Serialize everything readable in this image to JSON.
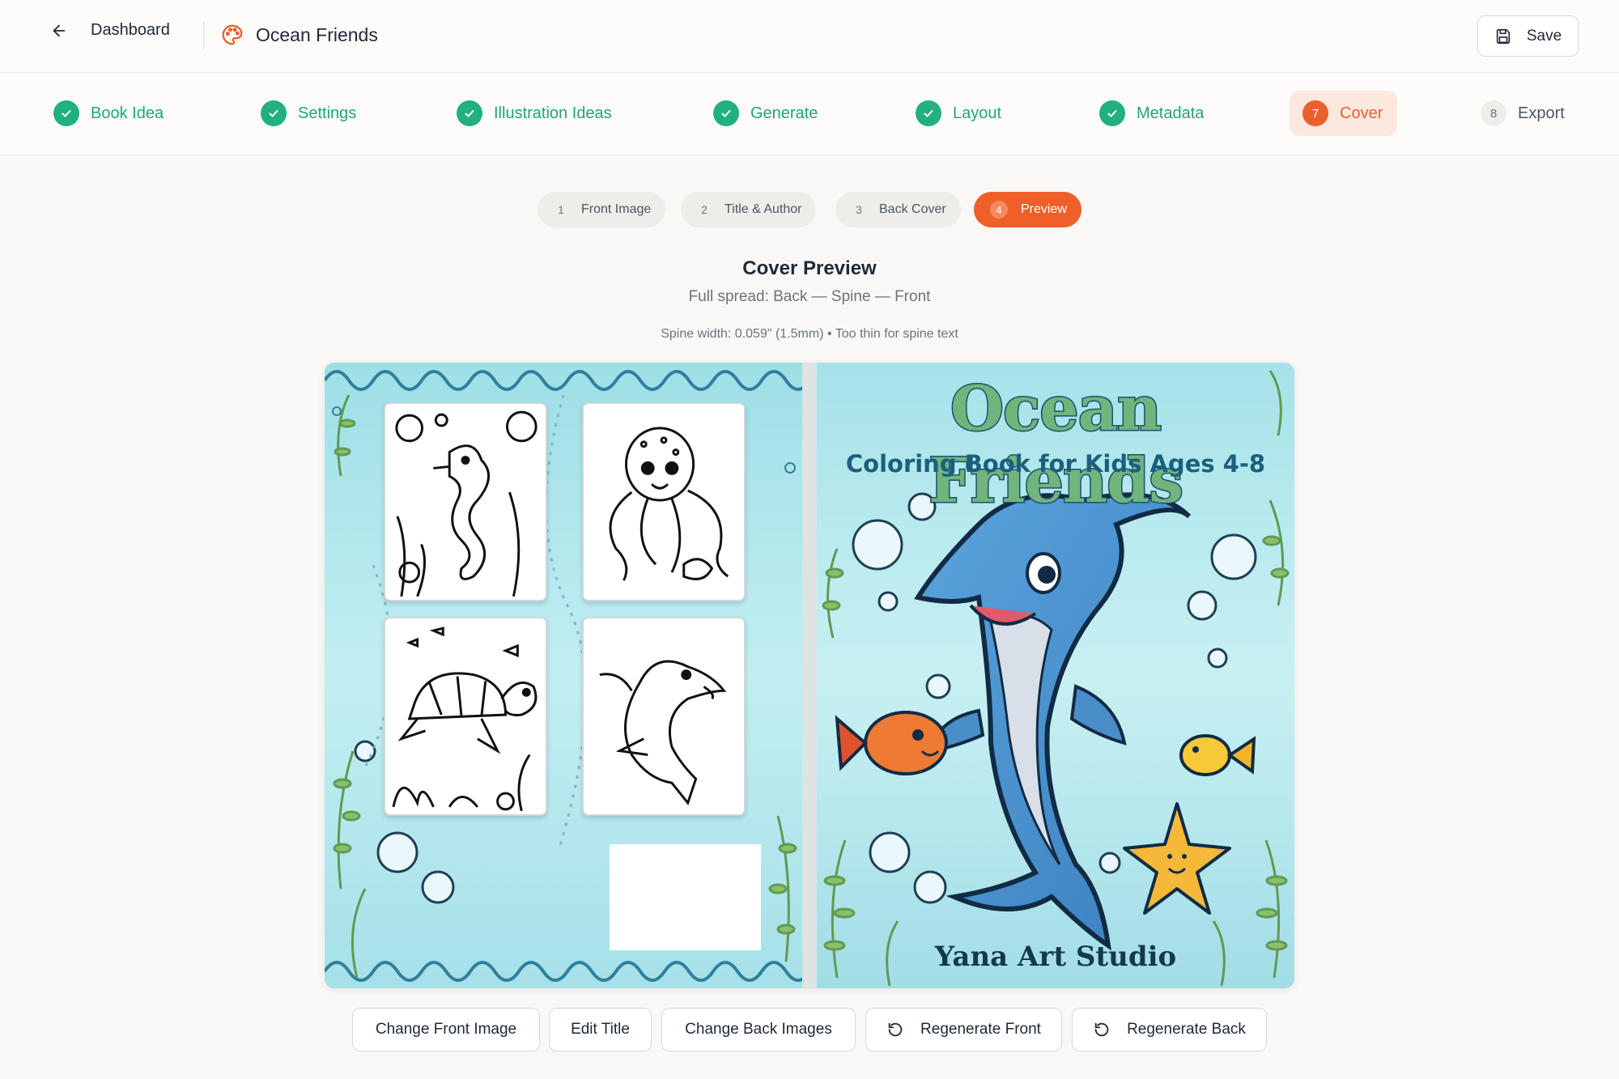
{
  "header": {
    "back_label": "Dashboard",
    "title": "Ocean Friends",
    "save_label": "Save",
    "back_icon": "arrow-left-icon",
    "title_icon": "palette-icon",
    "save_icon": "floppy-disk-icon"
  },
  "steps": [
    {
      "number": "1",
      "label": "Book Idea",
      "status": "done"
    },
    {
      "number": "2",
      "label": "Settings",
      "status": "done"
    },
    {
      "number": "3",
      "label": "Illustration Ideas",
      "status": "done"
    },
    {
      "number": "4",
      "label": "Generate",
      "status": "done"
    },
    {
      "number": "5",
      "label": "Layout",
      "status": "done"
    },
    {
      "number": "6",
      "label": "Metadata",
      "status": "done"
    },
    {
      "number": "7",
      "label": "Cover",
      "status": "active"
    },
    {
      "number": "8",
      "label": "Export",
      "status": "todo"
    }
  ],
  "cover_tabs": [
    {
      "number": "1",
      "label": "Front Image",
      "active": false
    },
    {
      "number": "2",
      "label": "Title & Author",
      "active": false
    },
    {
      "number": "3",
      "label": "Back Cover",
      "active": false
    },
    {
      "number": "4",
      "label": "Preview",
      "active": true
    }
  ],
  "preview": {
    "title": "Cover Preview",
    "subtitle": "Full spread: Back — Spine — Front",
    "spine_info": "Spine width: 0.059\" (1.5mm) • Too thin for spine text"
  },
  "cover": {
    "front_title": "Ocean Friends",
    "front_subtitle": "Coloring Book for Kids Ages 4-8",
    "author": "Yana Art Studio"
  },
  "actions": [
    {
      "label": "Change Front Image",
      "icon": ""
    },
    {
      "label": "Edit Title",
      "icon": ""
    },
    {
      "label": "Change Back Images",
      "icon": ""
    },
    {
      "label": "Regenerate Front",
      "icon": "refresh-icon"
    },
    {
      "label": "Regenerate Back",
      "icon": "refresh-icon"
    }
  ],
  "colors": {
    "accent": "#e8612c",
    "success": "#22b07e",
    "cover_bg": "#b4e6ec"
  }
}
